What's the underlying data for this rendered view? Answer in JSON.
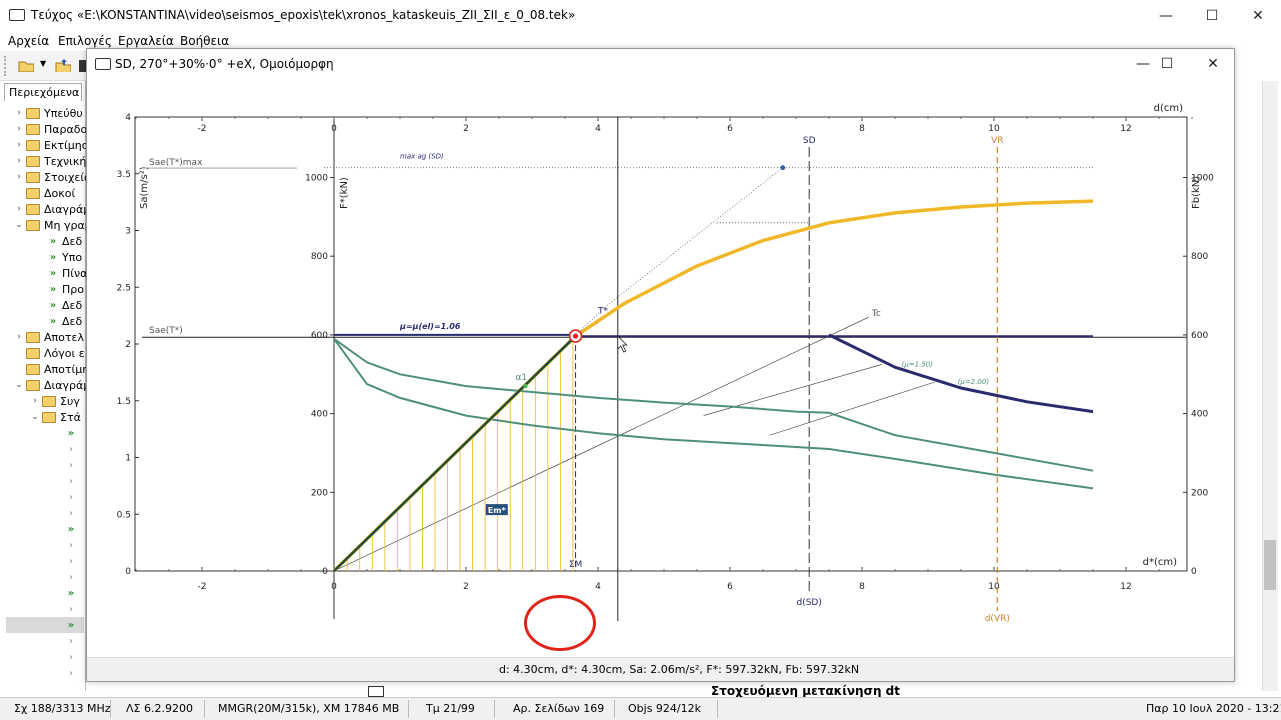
{
  "app": {
    "title": "Τεύχος «E:\\KONSTANTINA\\video\\seismos_epoxis\\tek\\xronos_kataskeuis_ZII_ΣII_ε_0_08.tek»",
    "window_buttons": {
      "minimize": "—",
      "maximize": "☐",
      "close": "✕"
    }
  },
  "menu": [
    "Αρχεία",
    "Επιλογές",
    "Εργαλεία",
    "Βοήθεια"
  ],
  "left_panel": {
    "tab_label": "Περιεχόμενα",
    "items": [
      {
        "kind": "folder",
        "expand": "›",
        "label": "Υπεύθυ"
      },
      {
        "kind": "folder",
        "expand": "›",
        "label": "Παραδο"
      },
      {
        "kind": "folder",
        "expand": "›",
        "label": "Εκτίμησ"
      },
      {
        "kind": "folder",
        "expand": "›",
        "label": "Τεχνική"
      },
      {
        "kind": "folder",
        "expand": "›",
        "label": "Στοιχεία"
      },
      {
        "kind": "folder",
        "expand": "",
        "label": "Δοκοί"
      },
      {
        "kind": "folder",
        "expand": "›",
        "label": "Διαγράμ"
      },
      {
        "kind": "folder",
        "expand": "⌄",
        "label": "Μη γραμ"
      },
      {
        "kind": "green",
        "label": "Δεδ"
      },
      {
        "kind": "green",
        "label": "Υπο"
      },
      {
        "kind": "green",
        "label": "Πίνα"
      },
      {
        "kind": "green",
        "label": "Προ"
      },
      {
        "kind": "green",
        "label": "Δεδ"
      },
      {
        "kind": "green",
        "label": "Δεδ"
      },
      {
        "kind": "folder",
        "expand": "›",
        "label": "Αποτελ"
      },
      {
        "kind": "folder",
        "expand": "",
        "label": "Λόγοι ε"
      },
      {
        "kind": "folder",
        "expand": "",
        "label": "Αποτίμη"
      },
      {
        "kind": "folder",
        "expand": "⌄",
        "label": "Διαγράμ"
      },
      {
        "kind": "folder2",
        "expand": "›",
        "label": "Συγ"
      },
      {
        "kind": "folder2",
        "expand": "⌄",
        "label": "Στά"
      }
    ],
    "arrow_rows": [
      "green",
      "gray",
      "gray",
      "gray",
      "gray",
      "gray",
      "green",
      "gray",
      "gray",
      "gray",
      "green",
      "gray",
      "green",
      "gray",
      "gray",
      "gray"
    ]
  },
  "child_window": {
    "title": "SD, 270°+30%·0° +eX, Ομοιόμορφη",
    "status": "d: 4.30cm, d*: 4.30cm, Sa: 2.06m/s², F*: 597.32kN, Fb: 597.32kN"
  },
  "chart_data": {
    "type": "line",
    "top_axis_label": "d(cm)",
    "bottom_axis_label": "d*(cm)",
    "left_axis_label": "Sa(m/s²)",
    "force_axis_label": "F*(kN)",
    "right_axis_label": "Fb(kN)",
    "x_ticks": [
      "-2",
      "0",
      "2",
      "4",
      "6",
      "8",
      "10",
      "12"
    ],
    "sa_ticks": [
      "0",
      "0.5",
      "1",
      "1.5",
      "2",
      "2.5",
      "3",
      "3.5",
      "4"
    ],
    "f_ticks": [
      "0",
      "200",
      "400",
      "600",
      "800",
      "1000"
    ],
    "labels": {
      "sae_max": "Sae(T*)max",
      "sae": "Sae(T*)",
      "max_ag": "max ag (SD)",
      "mu_el": "μ=μ(el)=1.06",
      "mu150": "(μ=1.50)",
      "mu200": "(μ=2.00)",
      "tstar": "T*",
      "tc": "Tc",
      "sd": "SD",
      "vr": "VR",
      "dsd": "d(SD)",
      "dvr": "d(VR)",
      "sm": "ΣΜ",
      "a1": "α1",
      "em": "Em*"
    },
    "capacity_curve": {
      "x": [
        0,
        3.66,
        4.4,
        5.5,
        6.5,
        7.5,
        8.5,
        9.5,
        10.5,
        11.5
      ],
      "y": [
        0,
        597,
        680,
        775,
        840,
        885,
        910,
        925,
        935,
        940
      ]
    },
    "inelastic_spectrum_mu106": {
      "x": [
        7.5,
        8.5,
        9.5,
        10.5,
        11.5
      ],
      "y": [
        600,
        518,
        465,
        430,
        405
      ]
    },
    "spectrum_mu150": {
      "x": [
        0,
        0.5,
        1,
        2,
        3,
        4,
        5,
        6,
        7,
        7.5,
        8.5,
        10,
        11.5
      ],
      "y": [
        590,
        530,
        500,
        470,
        455,
        440,
        428,
        418,
        405,
        402,
        345,
        300,
        255
      ]
    },
    "spectrum_mu200": {
      "x": [
        0,
        0.5,
        1,
        2,
        3,
        4,
        5,
        6,
        7,
        7.5,
        8.5,
        10,
        11.5
      ],
      "y": [
        590,
        475,
        440,
        395,
        370,
        350,
        335,
        325,
        315,
        310,
        285,
        245,
        210
      ]
    },
    "bilinear": {
      "x": [
        0,
        3.66,
        11.5
      ],
      "y": [
        0,
        597,
        597
      ]
    },
    "performance_point": {
      "d": 3.66,
      "F": 597
    },
    "d_sd": 7.2,
    "d_vr": 10.05,
    "d_cursor": 4.3,
    "xlim": [
      -3,
      13
    ],
    "flim": [
      0,
      1000
    ],
    "salim": [
      0,
      4
    ]
  },
  "statusbar": [
    "Σχ 188/3313 MHz",
    "ΛΣ 6.2.9200",
    "MMGR(20M/315k), XM 17846 MB",
    "Τμ 21/99",
    "Αρ. Σελίδων 169",
    "Objs 924/12k",
    "Παρ 10 Ιουλ 2020 - 13:21"
  ],
  "doc_peek": "Στοχευόμενη μετακίνηση dt",
  "colors": {
    "capacity": "#f0b828",
    "bilinear": "#2a2a6e",
    "spectrum": "#4f8f7a",
    "hatch": "#e8b820",
    "elastic": "#1f4d3a",
    "target": "#d9261c",
    "ring": "#e0241a"
  }
}
